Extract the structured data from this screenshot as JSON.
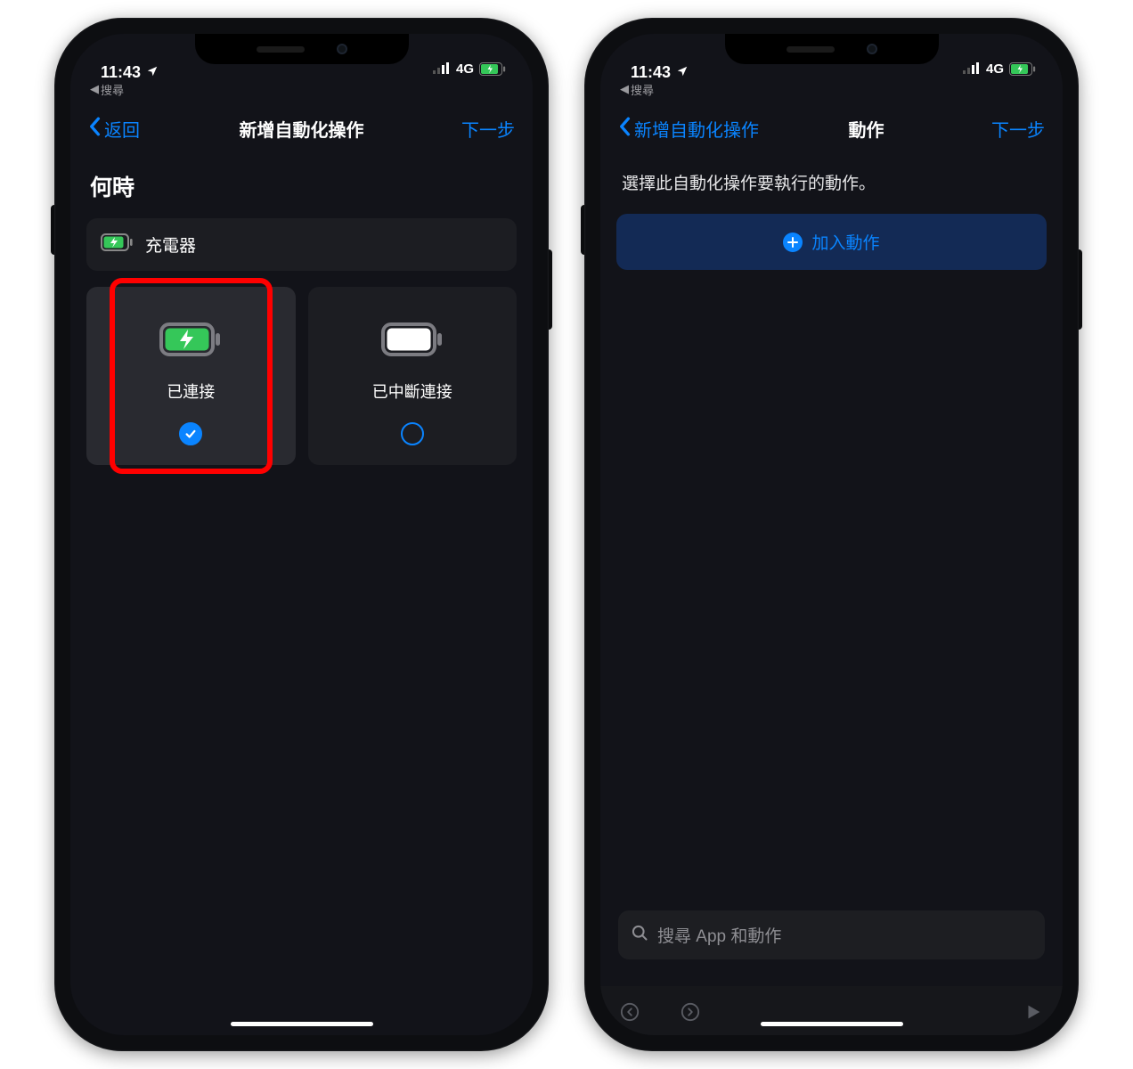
{
  "status": {
    "time": "11:43",
    "back_app": "搜尋",
    "network": "4G"
  },
  "phone1": {
    "nav": {
      "back": "返回",
      "title": "新增自動化操作",
      "next": "下一步"
    },
    "section": "何時",
    "trigger_row": "充電器",
    "options": {
      "connected": "已連接",
      "disconnected": "已中斷連接"
    }
  },
  "phone2": {
    "nav": {
      "back": "新增自動化操作",
      "title": "動作",
      "next": "下一步"
    },
    "prompt": "選擇此自動化操作要執行的動作。",
    "add_action": "加入動作",
    "search_placeholder": "搜尋 App 和動作"
  }
}
